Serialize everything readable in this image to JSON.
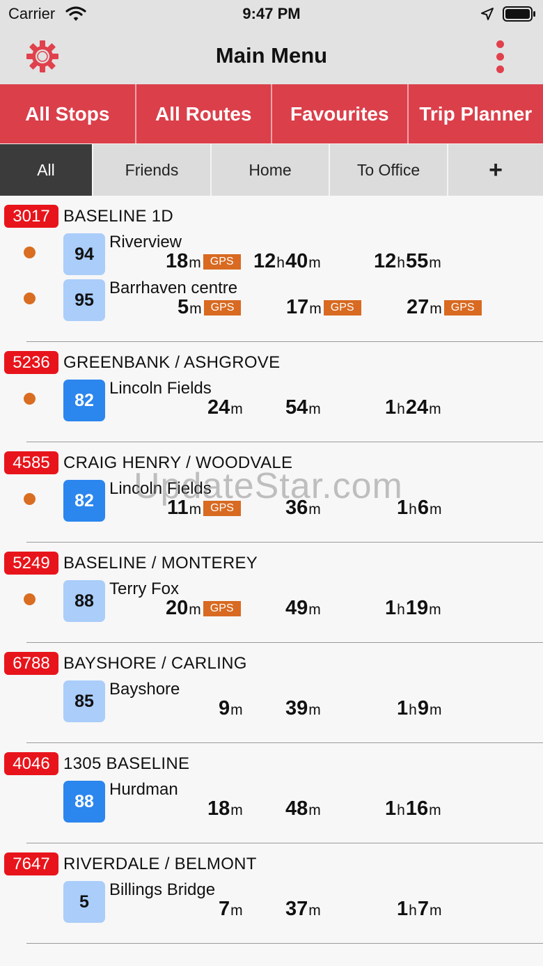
{
  "status_bar": {
    "carrier": "Carrier",
    "time": "9:47 PM"
  },
  "nav": {
    "title": "Main Menu"
  },
  "main_tabs": [
    "All Stops",
    "All Routes",
    "Favourites",
    "Trip Planner"
  ],
  "filter_tabs": [
    "All",
    "Friends",
    "Home",
    "To Office",
    "+"
  ],
  "watermark": "UpdateStar.com",
  "colors": {
    "accent": "#db3f4a",
    "stop_badge": "#e8141b",
    "gps": "#d86a21",
    "route_light": "#aacdfa",
    "route_dark": "#2b86ee"
  },
  "stops": [
    {
      "id": "3017",
      "name": "BASELINE 1D",
      "routes": [
        {
          "num": "94",
          "dest": "Riverview",
          "live": true,
          "style": "light",
          "times": [
            {
              "p1": "18",
              "u1": "m",
              "gps": "GPS"
            },
            {
              "p1": "12",
              "u1": "h",
              "p2": "40",
              "u2": "m"
            },
            {
              "p1": "12",
              "u1": "h",
              "p2": "55",
              "u2": "m"
            }
          ]
        },
        {
          "num": "95",
          "dest": "Barrhaven centre",
          "live": true,
          "style": "light",
          "times": [
            {
              "p1": "5",
              "u1": "m",
              "gps": "GPS"
            },
            {
              "p1": "17",
              "u1": "m",
              "gps": "GPS"
            },
            {
              "p1": "27",
              "u1": "m",
              "gps": "GPS"
            }
          ]
        }
      ]
    },
    {
      "id": "5236",
      "name": "GREENBANK / ASHGROVE",
      "routes": [
        {
          "num": "82",
          "dest": "Lincoln Fields",
          "live": true,
          "style": "dark",
          "times": [
            {
              "p1": "24",
              "u1": "m"
            },
            {
              "p1": "54",
              "u1": "m"
            },
            {
              "p1": "1",
              "u1": "h",
              "p2": "24",
              "u2": "m"
            }
          ]
        }
      ]
    },
    {
      "id": "4585",
      "name": "CRAIG HENRY / WOODVALE",
      "routes": [
        {
          "num": "82",
          "dest": "Lincoln Fields",
          "live": true,
          "style": "dark",
          "times": [
            {
              "p1": "11",
              "u1": "m",
              "gps": "GPS"
            },
            {
              "p1": "36",
              "u1": "m"
            },
            {
              "p1": "1",
              "u1": "h",
              "p2": "6",
              "u2": "m"
            }
          ]
        }
      ]
    },
    {
      "id": "5249",
      "name": "BASELINE / MONTEREY",
      "routes": [
        {
          "num": "88",
          "dest": "Terry Fox",
          "live": true,
          "style": "light",
          "times": [
            {
              "p1": "20",
              "u1": "m",
              "gps": "GPS"
            },
            {
              "p1": "49",
              "u1": "m"
            },
            {
              "p1": "1",
              "u1": "h",
              "p2": "19",
              "u2": "m"
            }
          ]
        }
      ]
    },
    {
      "id": "6788",
      "name": "BAYSHORE / CARLING",
      "routes": [
        {
          "num": "85",
          "dest": "Bayshore",
          "live": false,
          "style": "light",
          "times": [
            {
              "p1": "9",
              "u1": "m"
            },
            {
              "p1": "39",
              "u1": "m"
            },
            {
              "p1": "1",
              "u1": "h",
              "p2": "9",
              "u2": "m"
            }
          ]
        }
      ]
    },
    {
      "id": "4046",
      "name": "1305 BASELINE",
      "routes": [
        {
          "num": "88",
          "dest": "Hurdman",
          "live": false,
          "style": "dark",
          "times": [
            {
              "p1": "18",
              "u1": "m"
            },
            {
              "p1": "48",
              "u1": "m"
            },
            {
              "p1": "1",
              "u1": "h",
              "p2": "16",
              "u2": "m"
            }
          ]
        }
      ]
    },
    {
      "id": "7647",
      "name": "RIVERDALE / BELMONT",
      "routes": [
        {
          "num": "5",
          "dest": "Billings Bridge",
          "live": false,
          "style": "light",
          "times": [
            {
              "p1": "7",
              "u1": "m"
            },
            {
              "p1": "37",
              "u1": "m"
            },
            {
              "p1": "1",
              "u1": "h",
              "p2": "7",
              "u2": "m"
            }
          ]
        }
      ]
    }
  ]
}
